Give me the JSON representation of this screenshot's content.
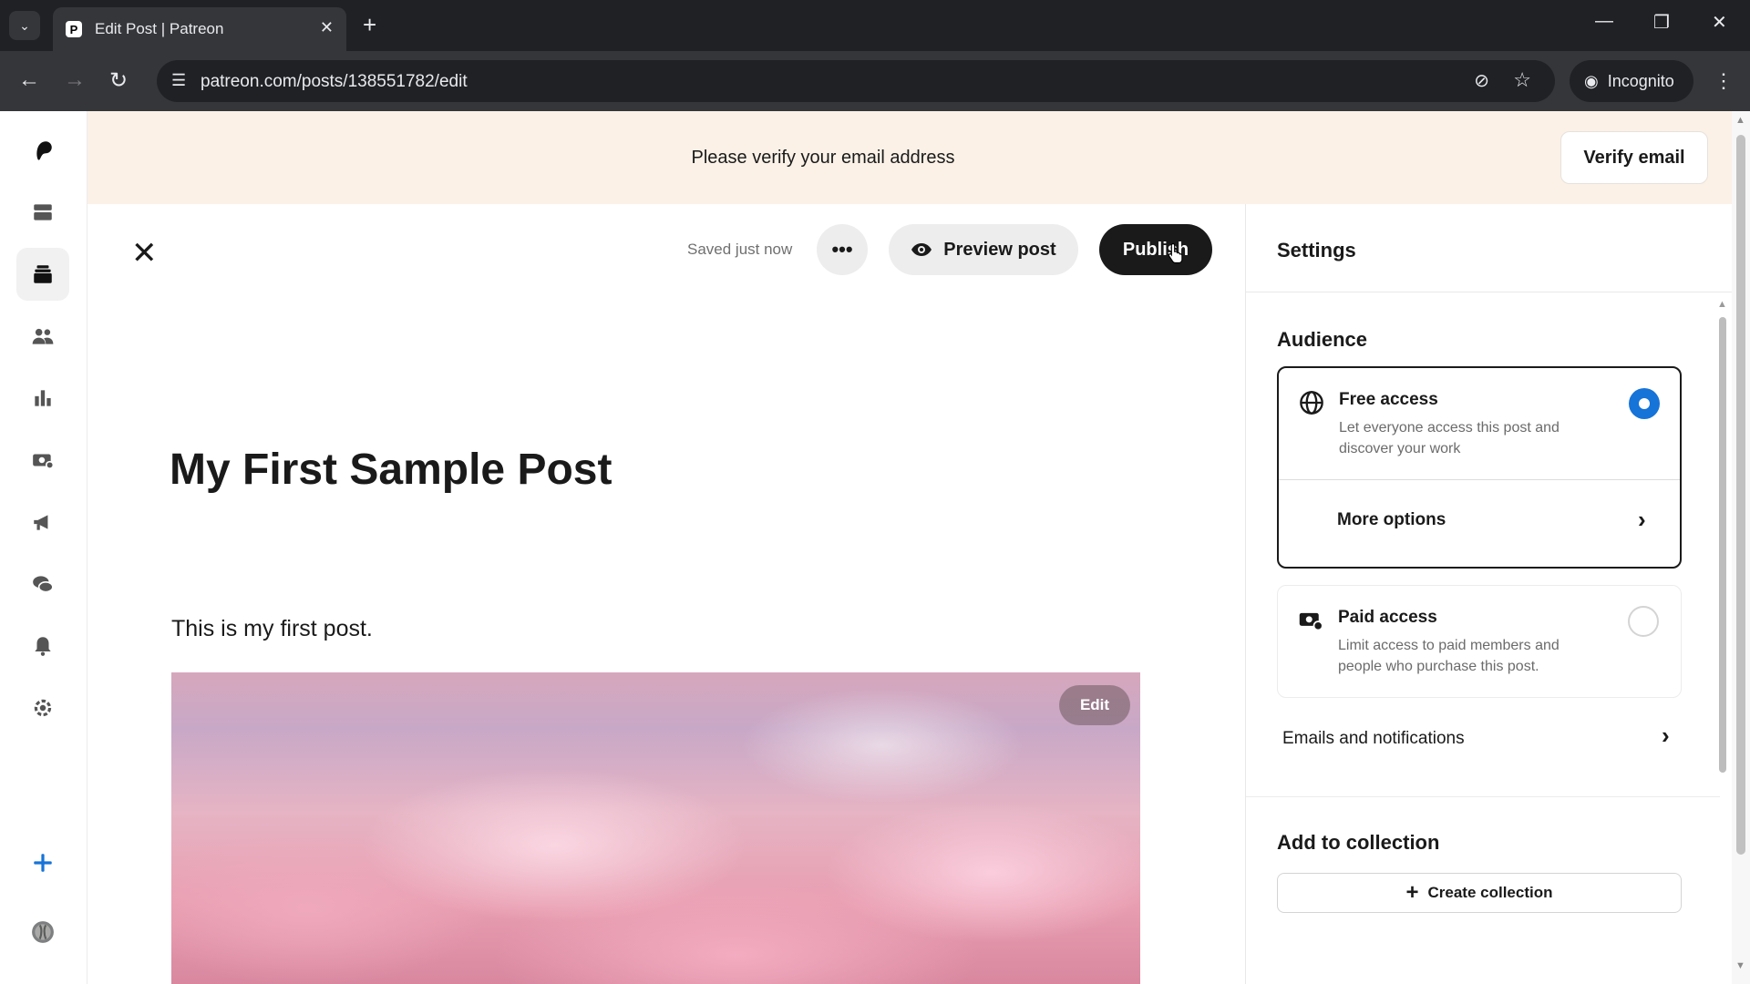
{
  "browser": {
    "tab_title": "Edit Post | Patreon",
    "url": "patreon.com/posts/138551782/edit",
    "incognito_label": "Incognito"
  },
  "banner": {
    "message": "Please verify your email address",
    "verify_button": "Verify email"
  },
  "editor": {
    "saved_status": "Saved just now",
    "preview_label": "Preview post",
    "publish_label": "Publish",
    "post_title": "My First Sample Post",
    "post_body": "This is my first post.",
    "image_edit_label": "Edit"
  },
  "rail": {
    "icons": [
      "patreon-logo-icon",
      "library-icon",
      "posts-icon",
      "audience-icon",
      "insights-icon",
      "payouts-icon",
      "promotions-icon",
      "chats-icon",
      "notifications-icon",
      "settings-icon",
      "create-icon",
      "avatar"
    ]
  },
  "settings": {
    "heading": "Settings",
    "audience_heading": "Audience",
    "free_access": {
      "title": "Free access",
      "description": "Let everyone access this post and discover your work",
      "selected": true
    },
    "more_options": "More options",
    "paid_access": {
      "title": "Paid access",
      "description": "Limit access to paid members and people who purchase this post.",
      "selected": false
    },
    "emails_notifications": "Emails and notifications",
    "collection_heading": "Add to collection",
    "create_collection": "Create collection"
  },
  "colors": {
    "banner_bg": "#fbf1e7",
    "publish_bg": "#1a1a1a",
    "radio_selected": "#1673d8",
    "browser_dark": "#202124"
  }
}
